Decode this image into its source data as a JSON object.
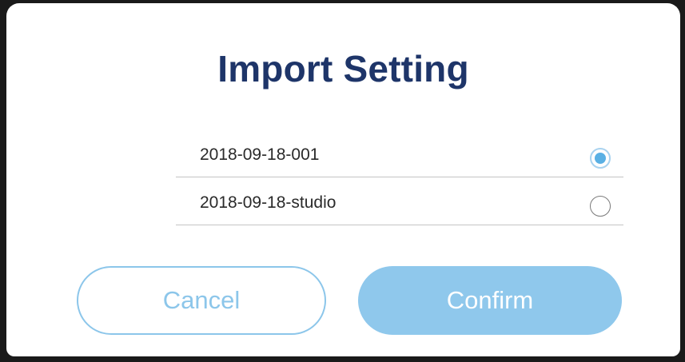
{
  "dialog": {
    "title": "Import Setting",
    "options": [
      {
        "label": "2018-09-18-001",
        "selected": true
      },
      {
        "label": "2018-09-18-studio",
        "selected": false
      }
    ],
    "cancel_label": "Cancel",
    "confirm_label": "Confirm"
  },
  "colors": {
    "title": "#1e3569",
    "accent": "#8fc8ec",
    "radio_selected": "#5ab0e4",
    "backdrop": "#1a1a1a"
  },
  "icons": {
    "radio_checked": "radio-checked-icon",
    "radio_unchecked": "radio-unchecked-icon"
  }
}
